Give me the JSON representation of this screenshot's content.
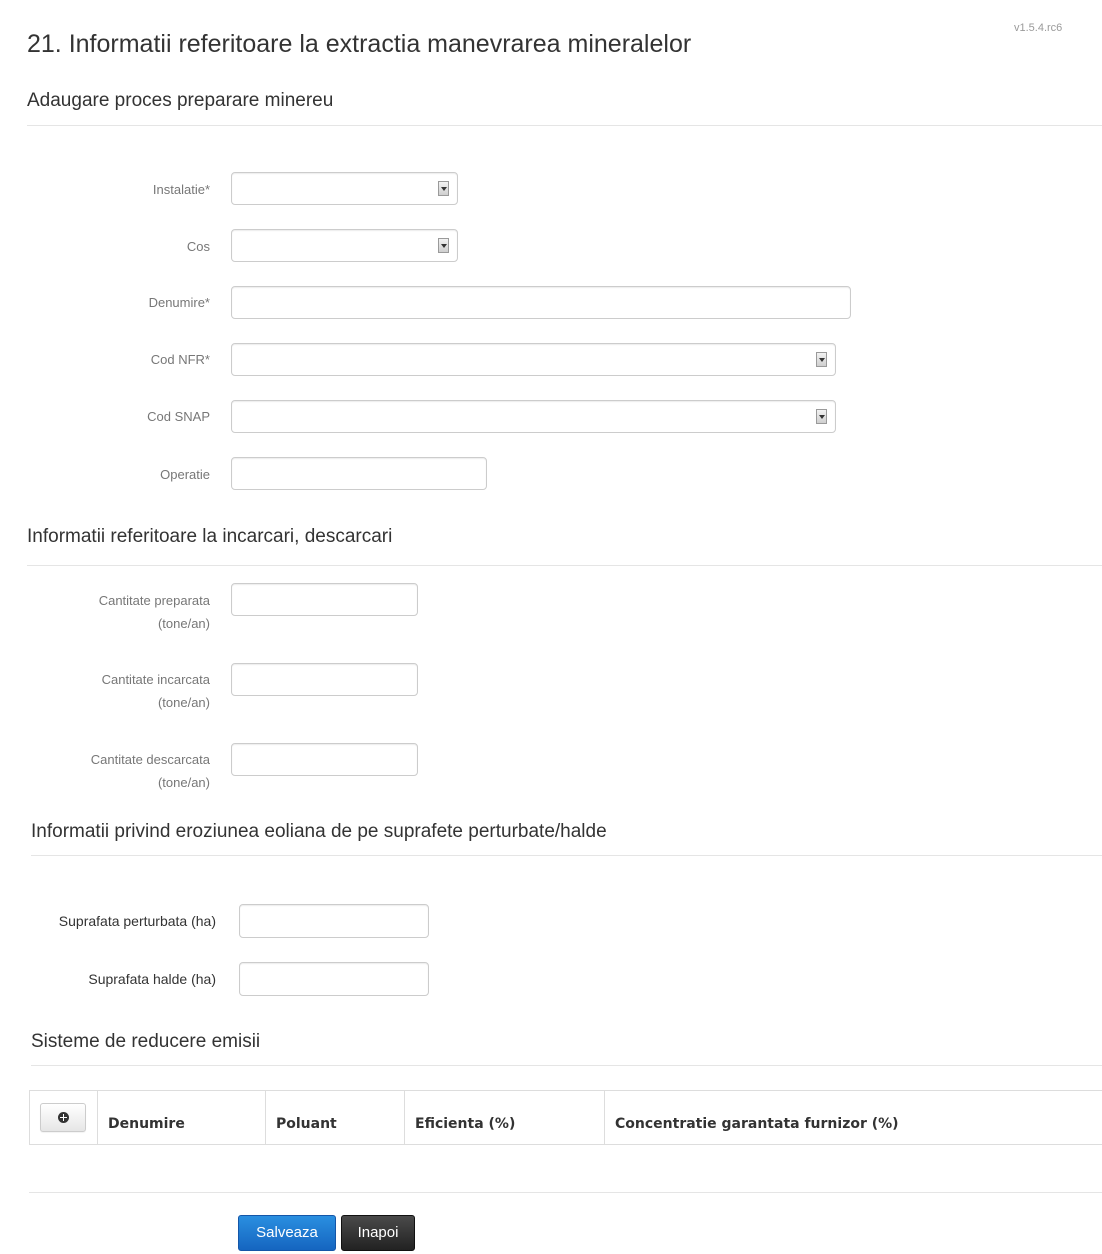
{
  "version": "v1.5.4.rc6",
  "page_title": "21. Informatii referitoare la extractia manevrarea mineralelor",
  "sections": {
    "process": {
      "title": "Adaugare proces preparare minereu",
      "fields": {
        "instalatie": {
          "label": "Instalatie*",
          "value": ""
        },
        "cos": {
          "label": "Cos",
          "value": ""
        },
        "denumire": {
          "label": "Denumire*",
          "value": ""
        },
        "cod_nfr": {
          "label": "Cod NFR*",
          "value": ""
        },
        "cod_snap": {
          "label": "Cod SNAP",
          "value": ""
        },
        "operatie": {
          "label": "Operatie",
          "value": ""
        }
      }
    },
    "loading": {
      "title": "Informatii referitoare la incarcari, descarcari",
      "fields": {
        "cantitate_preparata": {
          "label_line1": "Cantitate preparata",
          "label_line2": "(tone/an)",
          "value": ""
        },
        "cantitate_incarcata": {
          "label_line1": "Cantitate incarcata",
          "label_line2": "(tone/an)",
          "value": ""
        },
        "cantitate_descarcata": {
          "label_line1": "Cantitate descarcata",
          "label_line2": "(tone/an)",
          "value": ""
        }
      }
    },
    "erosion": {
      "title": "Informatii privind eroziunea eoliana de pe suprafete perturbate/halde",
      "fields": {
        "suprafata_perturbata": {
          "label": "Suprafata perturbata (ha)",
          "value": ""
        },
        "suprafata_halde": {
          "label": "Suprafata halde (ha)",
          "value": ""
        }
      }
    },
    "emissions": {
      "title": "Sisteme de reducere emisii",
      "table": {
        "columns": [
          "Denumire",
          "Poluant",
          "Eficienta (%)",
          "Concentratie garantata furnizor (%)"
        ],
        "rows": []
      }
    }
  },
  "buttons": {
    "save": "Salveaza",
    "back": "Inapoi"
  },
  "colors": {
    "primary": "#1a73d1",
    "dark": "#333333",
    "border": "#cccccc"
  },
  "icons": {
    "add": "plus-circle-icon",
    "select": "dropdown-arrow-icon"
  }
}
